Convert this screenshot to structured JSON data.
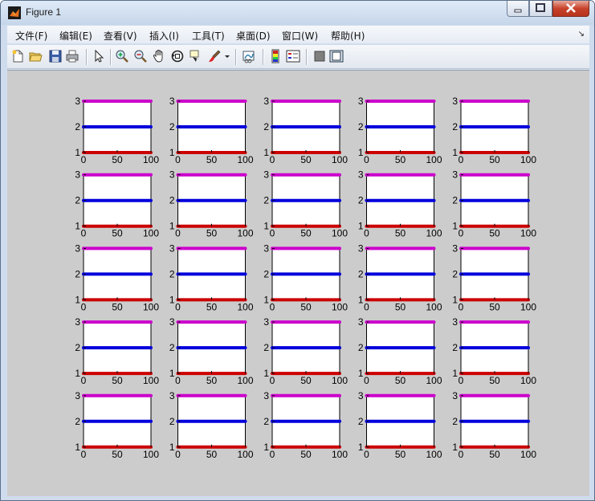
{
  "window": {
    "title": "Figure 1",
    "app_icon": "matlab-icon"
  },
  "window_buttons": [
    "minimize-icon",
    "maximize-icon",
    "close-icon"
  ],
  "menu": [
    {
      "id": "file",
      "label": "文件(F)"
    },
    {
      "id": "edit",
      "label": "编辑(E)"
    },
    {
      "id": "view",
      "label": "查看(V)"
    },
    {
      "id": "insert",
      "label": "插入(I)"
    },
    {
      "id": "tools",
      "label": "工具(T)"
    },
    {
      "id": "desktop",
      "label": "桌面(D)"
    },
    {
      "id": "window",
      "label": "窗口(W)"
    },
    {
      "id": "help",
      "label": "帮助(H)"
    }
  ],
  "toolbar": [
    "new-figure-icon",
    "open-file-icon",
    "save-icon",
    "print-icon",
    "select-arrow-icon",
    "zoom-in-icon",
    "zoom-out-icon",
    "pan-icon",
    "rotate-3d-icon",
    "data-cursor-icon",
    "brush-icon",
    "brush-dropdown-icon",
    "link-plot-icon",
    "colorbar-icon",
    "legend-icon",
    "hide-plot-tools-icon",
    "show-plot-tools-icon"
  ],
  "colors": {
    "series_1": "#cc0000",
    "series_2": "#0000dd",
    "series_3": "#cc00cc",
    "figure_bg": "#cccccc"
  },
  "chart_data": {
    "type": "scatter",
    "layout": "5x5 subplot grid",
    "subplots": 25,
    "xlim": [
      0,
      100
    ],
    "ylim": [
      1,
      3
    ],
    "xticks": [
      "0",
      "50",
      "100"
    ],
    "yticks": [
      "1",
      "2",
      "3"
    ],
    "series": [
      {
        "y": 1,
        "color": "#cc0000",
        "x_range": [
          0,
          100
        ]
      },
      {
        "y": 2,
        "color": "#0000dd",
        "x_range": [
          0,
          100
        ]
      },
      {
        "y": 3,
        "color": "#cc00cc",
        "x_range": [
          0,
          100
        ]
      }
    ]
  }
}
